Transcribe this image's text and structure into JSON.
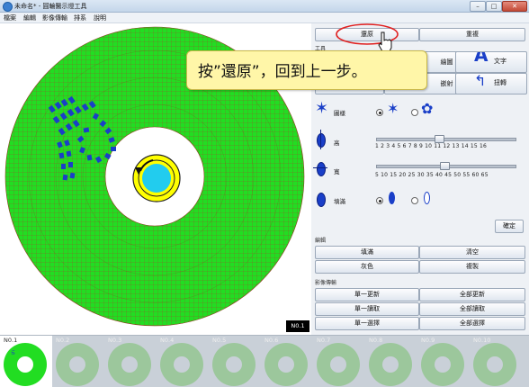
{
  "window": {
    "title": "未命名* - 圓輪醫示燈工具",
    "minimize": "–",
    "maximize": "□",
    "close": "✕"
  },
  "menu": [
    "檔案",
    "編輯",
    "影像傳輸",
    "排系",
    "說明"
  ],
  "top_buttons": {
    "restore": "還原",
    "redo": "重複"
  },
  "tools": {
    "section": "工具",
    "buttons": [
      "繪圖",
      "文字",
      "",
      "嵌射",
      "扭轉"
    ]
  },
  "brush": {
    "label": "圖樣",
    "options": [
      "star-small",
      "flower"
    ]
  },
  "height": {
    "label": "高",
    "ticks": "1 2 3 4 5 6 7 8 9 10 11 12 13 14 15 16",
    "value": 10
  },
  "width": {
    "label": "寬",
    "ticks": "5 10 15 20 25 30 35 40 45 50 55 60 65",
    "value": 35
  },
  "fill": {
    "label": "填滿",
    "options": [
      "filled",
      "outline"
    ]
  },
  "confirm": "確定",
  "edit": {
    "section": "編輯",
    "buttons": [
      "填滿",
      "清空",
      "灰色",
      "複製"
    ]
  },
  "transfer": {
    "section": "影像傳輸",
    "buttons": [
      "單一更新",
      "全部更新",
      "單一讀取",
      "全部讀取",
      "單一選擇",
      "全部選擇"
    ]
  },
  "current_badge": "N0.1",
  "thumbnails": [
    "N0.1",
    "N0.2",
    "N0.3",
    "N0.4",
    "N0.5",
    "N0.6",
    "N0.7",
    "N0.8",
    "N0.9",
    "N0.10"
  ],
  "callout": "按”還原”，回到上一步。",
  "colors": {
    "ring_green": "#22dd22",
    "grid_line": "#a04a2a",
    "pattern_blue": "#1a3fc8",
    "hub_yellow": "#ffff00",
    "hub_cyan": "#22ccee",
    "callout_bg": "#fff6a8",
    "highlight_red": "#e02020"
  }
}
